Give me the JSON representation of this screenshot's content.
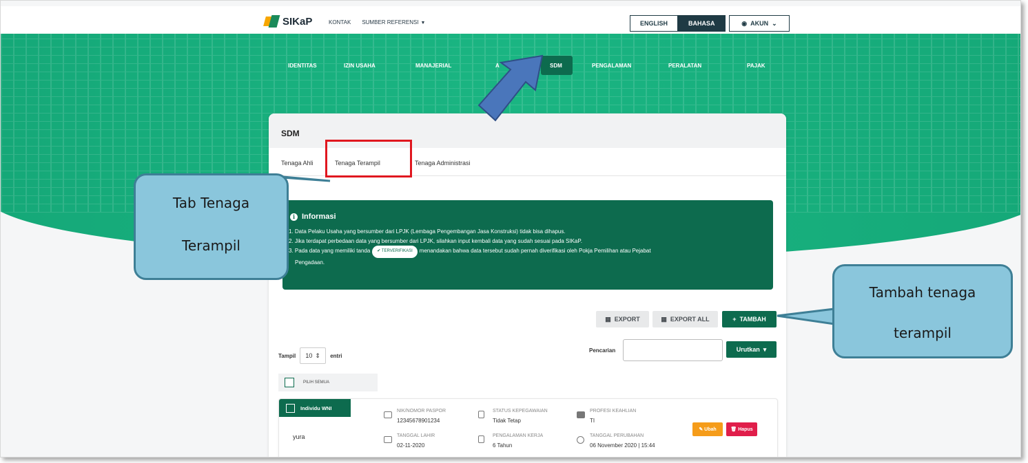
{
  "header": {
    "logo_text": "SIKaP",
    "nav": [
      "KONTAK",
      "SUMBER REFERENSI"
    ],
    "lang_english": "ENGLISH",
    "lang_bahasa": "BAHASA",
    "account": "AKUN"
  },
  "main_nav": {
    "items": [
      "IDENTITAS",
      "IZIN USAHA",
      "MANAJERIAL",
      "A",
      "SDM",
      "PENGALAMAN",
      "PERALATAN",
      "PAJAK"
    ],
    "active": "SDM"
  },
  "card": {
    "title": "SDM",
    "tabs": [
      "Tenaga Ahli",
      "Tenaga Terampil",
      "Tenaga Administrasi"
    ],
    "active_tab": "Tenaga Terampil"
  },
  "info": {
    "title": "Informasi",
    "line1": "1. Data Pelaku Usaha yang bersumber dari LPJK (Lembaga Pengembangan Jasa Konstruksi) tidak bisa dihapus.",
    "line2": "2. Jika terdapat perbedaan data yang bersumber dari LPJK, silahkan input kembali data yang sudah sesuai pada SIKaP.",
    "line3_pre": "3. Pada data yang memiliki tanda",
    "badge": "TERVERIFIKASI",
    "line3_post": "menandakan bahwa data tersebut sudah pernah diverifikasi oleh Pokja Pemilihan atau Pejabat",
    "line3_cont": "Pengadaan."
  },
  "actions": {
    "export": "EXPORT",
    "export_all": "EXPORT ALL",
    "tambah": "TAMBAH"
  },
  "table_controls": {
    "tampil": "Tampil",
    "entries_value": "10",
    "entri": "entri",
    "search_label": "Pencarian",
    "search_value": "",
    "sort": "Urutkan",
    "select_all": "PILIH SEMUA"
  },
  "row": {
    "tag": "Individu WNI",
    "name": "yura",
    "nik_label": "NIK/NOMOR PASPOR",
    "nik_value": "12345678901234",
    "status_label": "STATUS KEPEGAWAIAN",
    "status_value": "Tidak Tetap",
    "profesi_label": "PROFESI KEAHLIAN",
    "profesi_value": "TI",
    "lahir_label": "TANGGAL LAHIR",
    "lahir_value": "02-11-2020",
    "pengalaman_label": "PENGALAMAN KERJA",
    "pengalaman_value": "6 Tahun",
    "perubahan_label": "TANGGAL PERUBAHAN",
    "perubahan_value": "06 November 2020 | 15:44",
    "edit": "Ubah",
    "delete": "Hapus"
  },
  "callouts": {
    "tab_line1": "Tab Tenaga",
    "tab_line2": "Terampil",
    "add_line1": "Tambah tenaga",
    "add_line2": "terampil"
  },
  "colors": {
    "brand_green": "#1ab582",
    "dark_green": "#0d6b4e",
    "callout_blue": "#8ac6dc",
    "highlight_red": "#e0171f"
  }
}
